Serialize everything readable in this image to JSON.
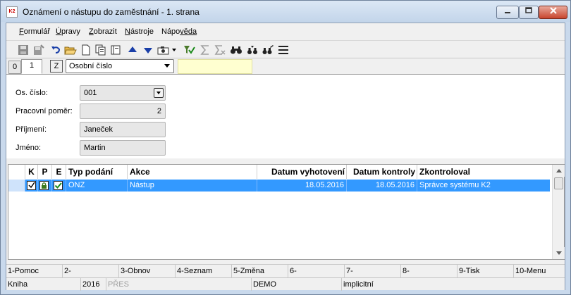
{
  "window": {
    "title": "Oznámení o nástupu do zaměstnání - 1. strana",
    "app_icon_label": "K2"
  },
  "menu": {
    "items": [
      {
        "key": "F",
        "rest": "ormulář"
      },
      {
        "key": "Ú",
        "rest": "pravy"
      },
      {
        "key": "Z",
        "rest": "obrazit"
      },
      {
        "key": "N",
        "rest": "ástroje"
      },
      {
        "key": "Nápo",
        "rest": "věda",
        "key_first": false
      }
    ]
  },
  "tabs": {
    "tab0": "0",
    "tab1": "1",
    "z_label": "Z",
    "sort_field": "Osobní číslo",
    "search_value": ""
  },
  "form": {
    "os_cislo_label": "Os. číslo:",
    "os_cislo_value": "001",
    "pracovni_pomer_label": "Pracovní poměr:",
    "pracovni_pomer_value": "2",
    "prijmeni_label": "Příjmení:",
    "prijmeni_value": "Janeček",
    "jmeno_label": "Jméno:",
    "jmeno_value": "Martin"
  },
  "grid": {
    "headers": {
      "k": "K",
      "p": "P",
      "e": "E",
      "typ_podani": "Typ podání",
      "akce": "Akce",
      "datum_vyhotoveni": "Datum vyhotovení",
      "datum_kontroly": "Datum kontroly",
      "zkontroloval": "Zkontroloval"
    },
    "rows": [
      {
        "typ_podani": "ONZ",
        "akce": "Nástup",
        "datum_vyhotoveni": "18.05.2016",
        "datum_kontroly": "18.05.2016",
        "zkontroloval": "Správce systému K2"
      }
    ]
  },
  "fkeys": [
    "1-Pomoc",
    "2-",
    "3-Obnov",
    "4-Seznam",
    "5-Změna",
    "6-",
    "7-",
    "8-",
    "9-Tisk",
    "10-Menu"
  ],
  "status": {
    "book": "Kniha",
    "year": "2016",
    "pres": "PŘES",
    "company": "DEMO",
    "mode": "implicitní"
  },
  "colors": {
    "selection": "#3399ff",
    "search_bg": "#ffffd0",
    "title_gradient_top": "#dbe7f5",
    "close_button": "#c8452e"
  }
}
